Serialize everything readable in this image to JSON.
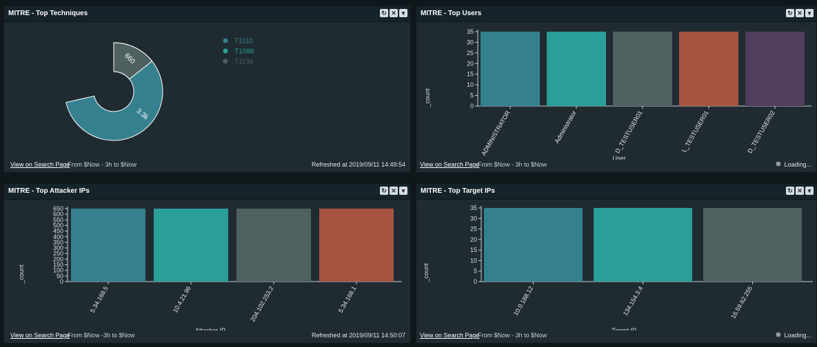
{
  "colors": {
    "teal_blue": "#35808f",
    "teal": "#2a9e99",
    "slate": "#4f6060",
    "coral": "#a65440",
    "plum": "#503e5c"
  },
  "icons": {
    "refresh": "refresh-icon",
    "close": "close-icon",
    "menu": "chevron-down-icon",
    "loading": "loading-icon"
  },
  "panels": {
    "techniques": {
      "title": "MITRE - Top Techniques",
      "link": "View on Search Page",
      "range": "From $Now - 3h to $Now",
      "status": "Refreshed at  2019/09/11 14:49:54"
    },
    "users": {
      "title": "MITRE - Top Users",
      "link": "View on Search Page",
      "range": "From $Now - 3h to $Now",
      "status": "Loading..."
    },
    "attackers": {
      "title": "MITRE - Top Attacker IPs",
      "link": "View on Search Page",
      "range": "From $Now -3h to $Now",
      "status": "Refreshed at  2019/09/11 14:50:07"
    },
    "targets": {
      "title": "MITRE - Top Target IPs",
      "link": "View on Search Page",
      "range": "From $Now - 3h to $Now",
      "status": "Loading..."
    }
  },
  "chart_data": [
    {
      "type": "pie",
      "donut": true,
      "labels": [
        "T1110",
        "T1098",
        "T1136"
      ],
      "values": [
        3300,
        660,
        660
      ],
      "slice_labels": [
        "3.3k",
        "660",
        "660"
      ],
      "colors": [
        "#35808f",
        "#2a9e99",
        "#4f6060"
      ],
      "legend": "top-right"
    },
    {
      "type": "bar",
      "categories": [
        "ADMINISTRATOR",
        "Administrator",
        "D_TESTUSER01",
        "L_TESTUSER01",
        "D_TESTUSER02"
      ],
      "values": [
        36,
        36,
        36,
        36,
        35
      ],
      "colors": [
        "#35808f",
        "#2a9e99",
        "#4f6060",
        "#a65440",
        "#503e5c"
      ],
      "xlabel": "User",
      "ylabel": "_count",
      "ylim": [
        0,
        35
      ],
      "yticks": [
        0,
        5,
        10,
        15,
        20,
        25,
        30,
        35
      ]
    },
    {
      "type": "bar",
      "categories": [
        "5.34.168.5",
        "10.4.21.96",
        "204.102.253.2",
        "5.34.168.1"
      ],
      "values": [
        660,
        660,
        660,
        660
      ],
      "colors": [
        "#35808f",
        "#2a9e99",
        "#4f6060",
        "#a65440"
      ],
      "xlabel": "Attacker IP",
      "ylabel": "_count",
      "ylim": [
        0,
        650
      ],
      "yticks": [
        0,
        50,
        100,
        150,
        200,
        250,
        300,
        350,
        400,
        450,
        500,
        550,
        600,
        650
      ]
    },
    {
      "type": "bar",
      "categories": [
        "10.0.188.12",
        "134.154.3.4",
        "16.59.62.255"
      ],
      "values": [
        36,
        36,
        36
      ],
      "colors": [
        "#35808f",
        "#2a9e99",
        "#4f6060"
      ],
      "xlabel": "Target IP",
      "ylabel": "_count",
      "ylim": [
        0,
        35
      ],
      "yticks": [
        0,
        5,
        10,
        15,
        20,
        25,
        30,
        35
      ]
    }
  ]
}
